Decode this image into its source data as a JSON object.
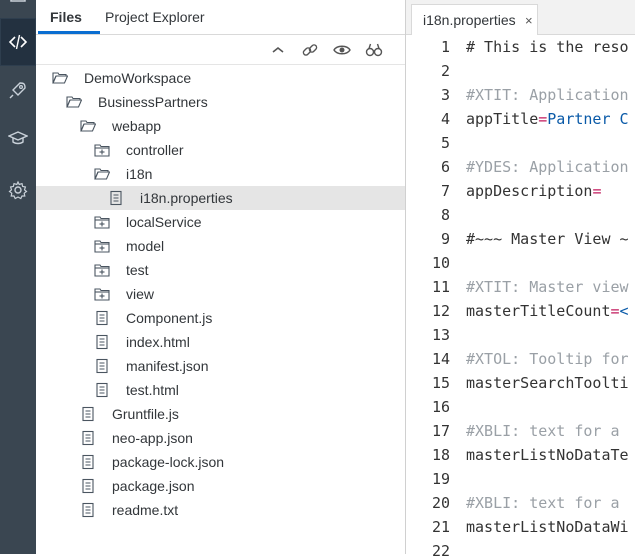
{
  "explorer": {
    "tabs": [
      {
        "label": "Files"
      },
      {
        "label": "Project Explorer"
      }
    ],
    "toolbar_icons": [
      "collapse-icon",
      "link-icon",
      "eye-icon",
      "binoculars-icon"
    ],
    "tree": [
      {
        "label": "DemoWorkspace",
        "kind": "folder-open",
        "depth": 0
      },
      {
        "label": "BusinessPartners",
        "kind": "folder-open",
        "depth": 1
      },
      {
        "label": "webapp",
        "kind": "folder-open",
        "depth": 2
      },
      {
        "label": "controller",
        "kind": "folder-plus",
        "depth": 3
      },
      {
        "label": "i18n",
        "kind": "folder-open",
        "depth": 3
      },
      {
        "label": "i18n.properties",
        "kind": "file",
        "depth": 4,
        "selected": true
      },
      {
        "label": "localService",
        "kind": "folder-plus",
        "depth": 3
      },
      {
        "label": "model",
        "kind": "folder-plus",
        "depth": 3
      },
      {
        "label": "test",
        "kind": "folder-plus",
        "depth": 3
      },
      {
        "label": "view",
        "kind": "folder-plus",
        "depth": 3
      },
      {
        "label": "Component.js",
        "kind": "file",
        "depth": 3
      },
      {
        "label": "index.html",
        "kind": "file",
        "depth": 3
      },
      {
        "label": "manifest.json",
        "kind": "file",
        "depth": 3
      },
      {
        "label": "test.html",
        "kind": "file",
        "depth": 3
      },
      {
        "label": "Gruntfile.js",
        "kind": "file",
        "depth": 2
      },
      {
        "label": "neo-app.json",
        "kind": "file",
        "depth": 2
      },
      {
        "label": "package-lock.json",
        "kind": "file",
        "depth": 2
      },
      {
        "label": "package.json",
        "kind": "file",
        "depth": 2
      },
      {
        "label": "readme.txt",
        "kind": "file",
        "depth": 2
      }
    ]
  },
  "editor": {
    "tab_label": "i18n.properties",
    "tab_close": "×",
    "lines": [
      {
        "n": "1",
        "parts": [
          {
            "t": "# This is the reso",
            "c": "k"
          }
        ]
      },
      {
        "n": "2",
        "parts": []
      },
      {
        "n": "3",
        "parts": [
          {
            "t": "#XTIT: Application",
            "c": "c"
          }
        ]
      },
      {
        "n": "4",
        "parts": [
          {
            "t": "appTitle",
            "c": "k"
          },
          {
            "t": "=",
            "c": "eq"
          },
          {
            "t": "Partner C",
            "c": "v"
          }
        ]
      },
      {
        "n": "5",
        "parts": []
      },
      {
        "n": "6",
        "parts": [
          {
            "t": "#YDES: Application",
            "c": "c"
          }
        ]
      },
      {
        "n": "7",
        "parts": [
          {
            "t": "appDescription",
            "c": "k"
          },
          {
            "t": "=",
            "c": "eq"
          }
        ]
      },
      {
        "n": "8",
        "parts": []
      },
      {
        "n": "9",
        "parts": [
          {
            "t": "#~~~ Master View ~",
            "c": "k"
          }
        ]
      },
      {
        "n": "10",
        "parts": []
      },
      {
        "n": "11",
        "parts": [
          {
            "t": "#XTIT: Master view",
            "c": "c"
          }
        ]
      },
      {
        "n": "12",
        "parts": [
          {
            "t": "masterTitleCount",
            "c": "k"
          },
          {
            "t": "=",
            "c": "eq"
          },
          {
            "t": "<",
            "c": "v"
          }
        ]
      },
      {
        "n": "13",
        "parts": []
      },
      {
        "n": "14",
        "parts": [
          {
            "t": "#XTOL: Tooltip for",
            "c": "c"
          }
        ]
      },
      {
        "n": "15",
        "parts": [
          {
            "t": "masterSearchToolti",
            "c": "k"
          }
        ]
      },
      {
        "n": "16",
        "parts": []
      },
      {
        "n": "17",
        "parts": [
          {
            "t": "#XBLI: text for a",
            "c": "c"
          }
        ]
      },
      {
        "n": "18",
        "parts": [
          {
            "t": "masterListNoDataTe",
            "c": "k"
          }
        ]
      },
      {
        "n": "19",
        "parts": []
      },
      {
        "n": "20",
        "parts": [
          {
            "t": "#XBLI: text for a",
            "c": "c"
          }
        ]
      },
      {
        "n": "21",
        "parts": [
          {
            "t": "masterListNoDataWi",
            "c": "k"
          }
        ]
      },
      {
        "n": "22",
        "parts": []
      }
    ]
  }
}
